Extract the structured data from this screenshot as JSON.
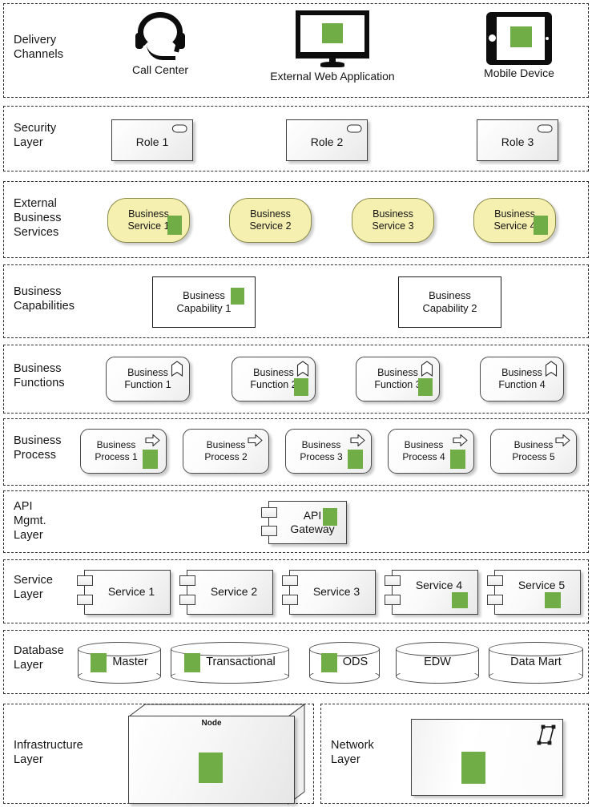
{
  "theme": {
    "accent_green": "#70ad47",
    "service_yellow": "#f5f0b0",
    "line": "#2b2b2b"
  },
  "layers": [
    {
      "id": "delivery-channels",
      "label": "Delivery\nChannels",
      "channels": [
        {
          "name": "Call  Center",
          "icon": "headset-icon",
          "has_green": false
        },
        {
          "name": "External Web Application",
          "icon": "desktop-monitor-icon",
          "has_green": true
        },
        {
          "name": "Mobile Device",
          "icon": "tablet-icon",
          "has_green": true
        }
      ]
    },
    {
      "id": "security-layer",
      "label": "Security\nLayer",
      "roles": [
        {
          "name": "Role 1",
          "icon": "business-role-icon"
        },
        {
          "name": "Role 2",
          "icon": "business-role-icon"
        },
        {
          "name": "Role 3",
          "icon": "business-role-icon"
        }
      ]
    },
    {
      "id": "external-business-services",
      "label": "External\nBusiness\nServices",
      "services": [
        {
          "name": "Business\nService 1",
          "has_green": true
        },
        {
          "name": "Business\nService 2",
          "has_green": false
        },
        {
          "name": "Business\nService 3",
          "has_green": false
        },
        {
          "name": "Business\nService 4",
          "has_green": true
        }
      ]
    },
    {
      "id": "business-capabilities",
      "label": "Business\nCapabilities",
      "capabilities": [
        {
          "name": "Business\nCapability 1",
          "has_green": true
        },
        {
          "name": "Business\nCapability 2",
          "has_green": false
        }
      ]
    },
    {
      "id": "business-functions",
      "label": "Business\nFunctions",
      "functions": [
        {
          "name": "Business\nFunction 1",
          "has_green": false
        },
        {
          "name": "Business\nFunction 2",
          "has_green": true
        },
        {
          "name": "Business\nFunction 3",
          "has_green": true
        },
        {
          "name": "Business\nFunction 4",
          "has_green": false
        }
      ]
    },
    {
      "id": "business-process",
      "label": "Business\nProcess",
      "processes": [
        {
          "name": "Business\nProcess 1",
          "has_green": true
        },
        {
          "name": "Business\nProcess 2",
          "has_green": false
        },
        {
          "name": "Business\nProcess 3",
          "has_green": true
        },
        {
          "name": "Business\nProcess 4",
          "has_green": true
        },
        {
          "name": "Business\nProcess 5",
          "has_green": false
        }
      ]
    },
    {
      "id": "api-mgmt-layer",
      "label": "API\nMgmt.\nLayer",
      "components": [
        {
          "name": "API\nGateway",
          "has_green": true
        }
      ]
    },
    {
      "id": "service-layer",
      "label": "Service\nLayer",
      "components": [
        {
          "name": "Service 1",
          "has_green": false
        },
        {
          "name": "Service 2",
          "has_green": false
        },
        {
          "name": "Service 3",
          "has_green": false
        },
        {
          "name": "Service 4",
          "has_green": true
        },
        {
          "name": "Service 5",
          "has_green": true
        }
      ]
    },
    {
      "id": "database-layer",
      "label": "Database\nLayer",
      "databases": [
        {
          "name": "Master",
          "has_green": true
        },
        {
          "name": "Transactional",
          "has_green": true
        },
        {
          "name": "ODS",
          "has_green": true
        },
        {
          "name": "EDW",
          "has_green": false
        },
        {
          "name": "Data Mart",
          "has_green": false
        }
      ]
    },
    {
      "id": "infrastructure-layer",
      "label": "Infrastructure\nLayer",
      "node": {
        "name": "Node",
        "has_green": true
      }
    },
    {
      "id": "network-layer",
      "label": "Network\nLayer",
      "network": {
        "name": "",
        "icon": "network-icon",
        "has_green": true
      }
    }
  ]
}
